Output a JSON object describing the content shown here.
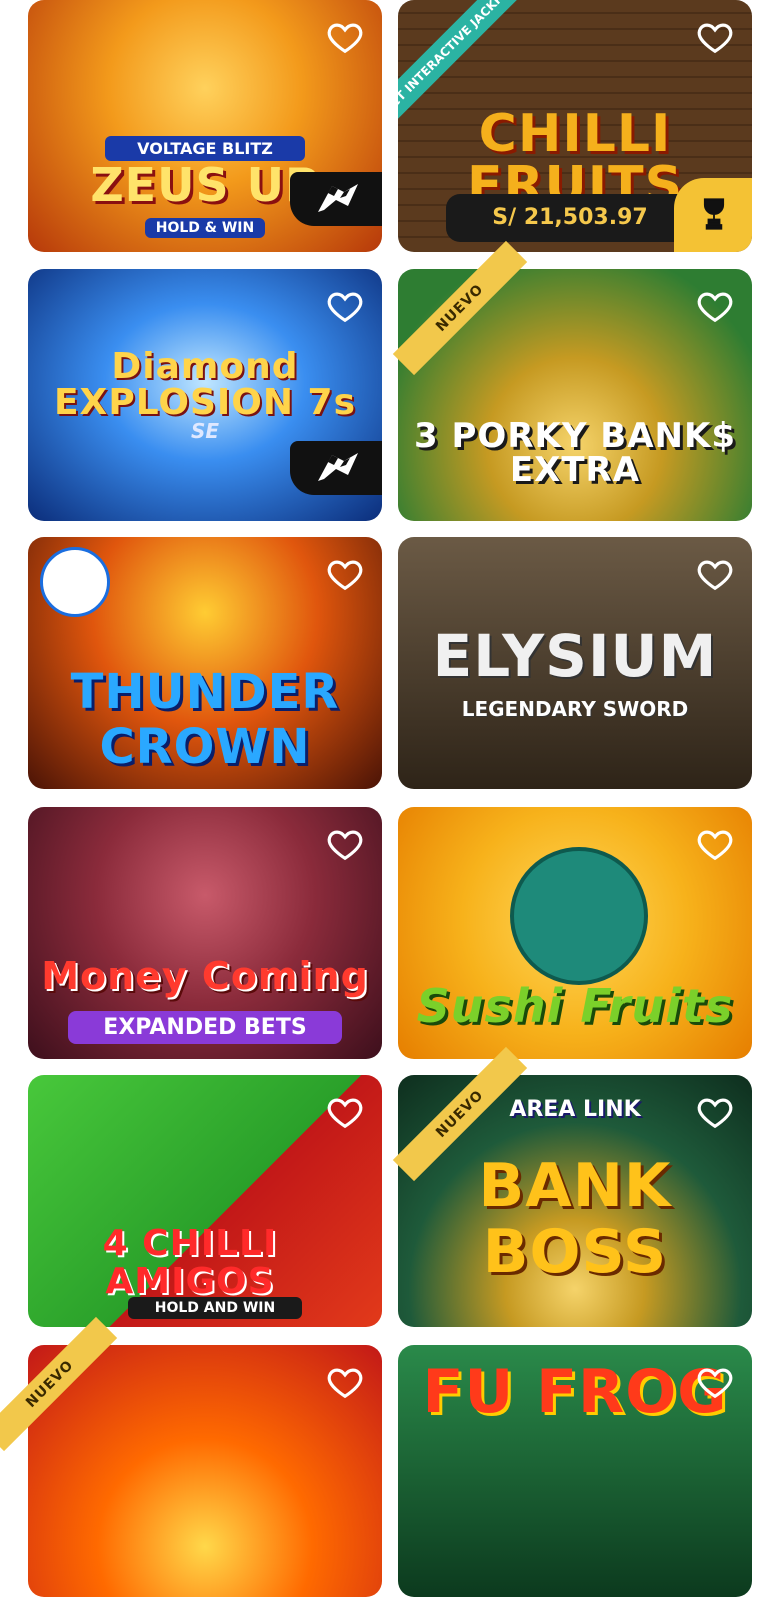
{
  "badges": {
    "new": "NUEVO"
  },
  "games": [
    {
      "title": "ZEUS UP",
      "subtitle": "VOLTAGE BLITZ",
      "tagline": "HOLD & WIN",
      "colors": [
        "#f39a1b",
        "#c2410c"
      ]
    },
    {
      "title": "CHILLI FRUITS",
      "corner": "CT INTERACTIVE JACKPOT",
      "jackpot": "S/ 21,503.97",
      "colors": [
        "#5b3a1e",
        "#2e1c0d"
      ]
    },
    {
      "title": "Diamond EXPLOSION 7s",
      "subtitle": "SE",
      "colors": [
        "#1e6fd9",
        "#0b2d7a"
      ]
    },
    {
      "title": "3 PORKY BANK$ EXTRA",
      "colors": [
        "#2e7d32",
        "#1b4d20"
      ]
    },
    {
      "title": "THUNDER CROWN",
      "colors": [
        "#c2410c",
        "#5a1b0a"
      ]
    },
    {
      "title": "ELYSIUM",
      "subtitle": "LEGENDARY SWORD",
      "colors": [
        "#4a3a2a",
        "#1c140c"
      ]
    },
    {
      "title": "Money Coming",
      "tagline": "EXPANDED BETS",
      "colors": [
        "#8b2b3b",
        "#3d0f1c"
      ]
    },
    {
      "title": "Sushi Fruits",
      "colors": [
        "#f7b21b",
        "#e67e00"
      ]
    },
    {
      "title": "4 CHILLI AMIGOS",
      "tagline": "HOLD AND WIN",
      "colors": [
        "#48c83b",
        "#1e8a1c"
      ]
    },
    {
      "title": "BANK BOSS",
      "subtitle": "AREA LINK",
      "colors": [
        "#1e5a3a",
        "#0e2e1e"
      ]
    },
    {
      "title": "",
      "colors": [
        "#ff6a00",
        "#c21818"
      ]
    },
    {
      "title": "FU FROG",
      "colors": [
        "#1e6e3a",
        "#0c3a1e"
      ]
    }
  ]
}
